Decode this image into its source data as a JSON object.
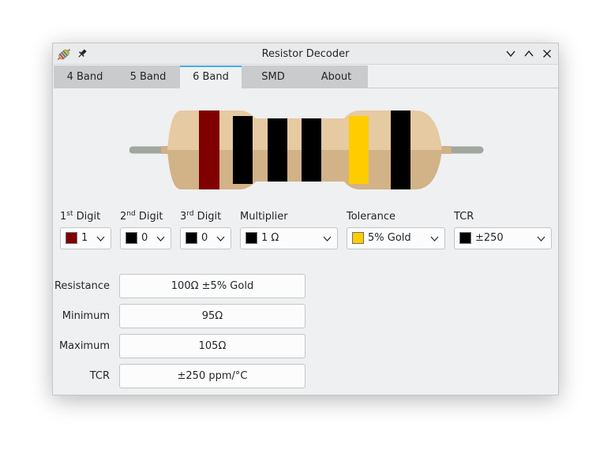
{
  "window": {
    "title": "Resistor Decoder"
  },
  "icons": {
    "app": "resistor-app-icon",
    "pin": "pin-icon",
    "minimize": "chevron-down-icon",
    "maximize": "chevron-up-icon",
    "close": "close-icon"
  },
  "tabs": [
    {
      "label": "4 Band",
      "active": false
    },
    {
      "label": "5 Band",
      "active": false
    },
    {
      "label": "6 Band",
      "active": true
    },
    {
      "label": "SMD",
      "active": false
    },
    {
      "label": "About",
      "active": false
    }
  ],
  "resistor": {
    "body_color": "#e6caa2",
    "bands": [
      {
        "name": "1st-digit",
        "color": "#800000"
      },
      {
        "name": "2nd-digit",
        "color": "#000000"
      },
      {
        "name": "3rd-digit",
        "color": "#000000"
      },
      {
        "name": "multiplier",
        "color": "#000000"
      },
      {
        "name": "tolerance",
        "color": "#ffcc00"
      },
      {
        "name": "tcr",
        "color": "#000000"
      }
    ]
  },
  "selectors": [
    {
      "label_main": "1",
      "label_sup": "st",
      "label_rest": " Digit",
      "value": "1",
      "swatch": "#800000"
    },
    {
      "label_main": "2",
      "label_sup": "nd",
      "label_rest": " Digit",
      "value": "0",
      "swatch": "#000000"
    },
    {
      "label_main": "3",
      "label_sup": "rd",
      "label_rest": " Digit",
      "value": "0",
      "swatch": "#000000"
    },
    {
      "label_main": "Multiplier",
      "label_sup": "",
      "label_rest": "",
      "value": "1 Ω",
      "swatch": "#000000"
    },
    {
      "label_main": "Tolerance",
      "label_sup": "",
      "label_rest": "",
      "value": "5% Gold",
      "swatch": "#ffcc00"
    },
    {
      "label_main": "TCR",
      "label_sup": "",
      "label_rest": "",
      "value": "±250",
      "swatch": "#000000"
    }
  ],
  "results": [
    {
      "label": "Resistance",
      "value": "100Ω ±5% Gold"
    },
    {
      "label": "Minimum",
      "value": "95Ω"
    },
    {
      "label": "Maximum",
      "value": "105Ω"
    },
    {
      "label": "TCR",
      "value": "±250 ppm/°C"
    }
  ]
}
